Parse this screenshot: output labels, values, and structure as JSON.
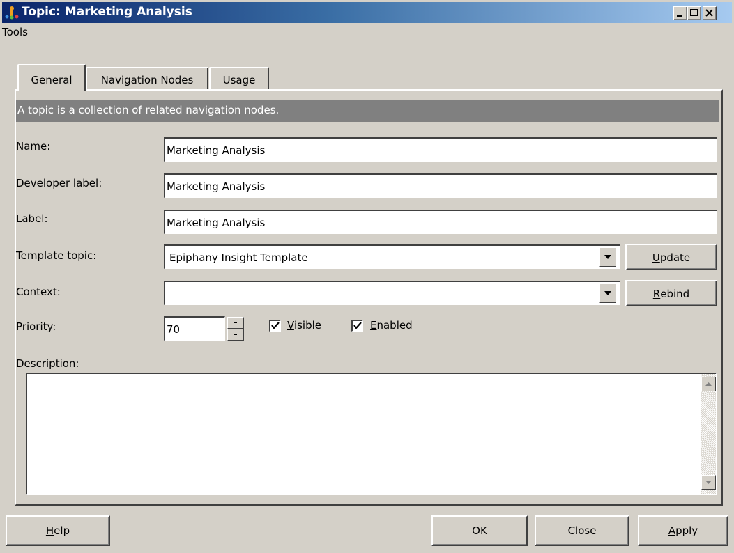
{
  "window": {
    "title": "Topic: Marketing Analysis"
  },
  "menu": {
    "tools": "Tools"
  },
  "tabs": [
    {
      "label": "General",
      "active": true
    },
    {
      "label": "Navigation Nodes",
      "active": false
    },
    {
      "label": "Usage",
      "active": false
    }
  ],
  "info": "A topic is a collection of related navigation nodes.",
  "form": {
    "name_label": "Name:",
    "name_value": "Marketing Analysis",
    "dev_label": "Developer label:",
    "dev_value": "Marketing Analysis",
    "label_label": "Label:",
    "label_value": "Marketing Analysis",
    "template_label": "Template topic:",
    "template_value": "Epiphany Insight Template",
    "context_label": "Context:",
    "context_value": "",
    "priority_label": "Priority:",
    "priority_value": "70",
    "description_label": "Description:",
    "description_value": ""
  },
  "buttons": {
    "update": {
      "accel": "U",
      "rest": "pdate"
    },
    "rebind": {
      "accel": "R",
      "rest": "ebind"
    },
    "help": {
      "pre": "",
      "accel": "H",
      "rest": "elp"
    },
    "ok": "OK",
    "close": "Close",
    "apply": {
      "accel": "A",
      "rest": "pply"
    }
  },
  "checks": {
    "visible": {
      "accel": "V",
      "rest": "isible",
      "checked": true
    },
    "enabled": {
      "accel": "E",
      "rest": "nabled",
      "checked": true
    }
  }
}
